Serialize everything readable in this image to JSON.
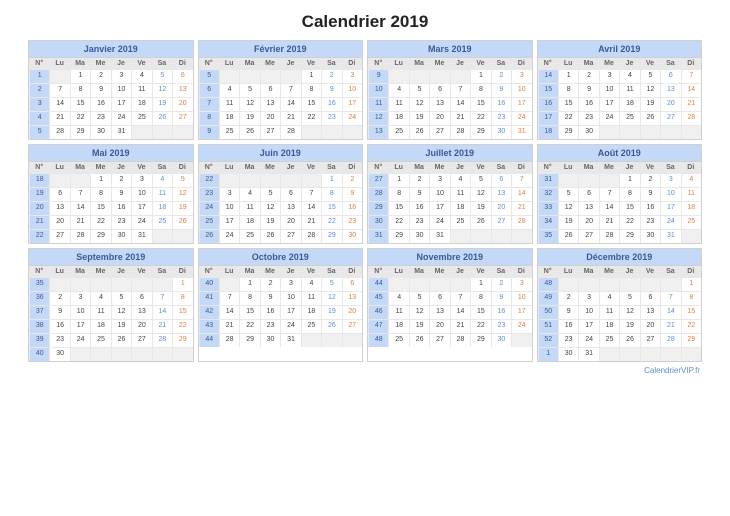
{
  "title": "Calendrier 2019",
  "footer": "CalendrierVIP.fr",
  "dayHeaders": [
    "N°",
    "Lu",
    "Ma",
    "Me",
    "Je",
    "Ve",
    "Sa",
    "Di"
  ],
  "months": [
    {
      "name": "Janvier 2019",
      "weeks": [
        {
          "n": 1,
          "d": [
            "",
            "1",
            "2",
            "3",
            "4",
            "5",
            "6"
          ]
        },
        {
          "n": 2,
          "d": [
            "7",
            "8",
            "9",
            "10",
            "11",
            "12",
            "13"
          ]
        },
        {
          "n": 3,
          "d": [
            "14",
            "15",
            "16",
            "17",
            "18",
            "19",
            "20"
          ]
        },
        {
          "n": 4,
          "d": [
            "21",
            "22",
            "23",
            "24",
            "25",
            "26",
            "27"
          ]
        },
        {
          "n": 5,
          "d": [
            "28",
            "29",
            "30",
            "31",
            "",
            "",
            ""
          ]
        }
      ]
    },
    {
      "name": "Février 2019",
      "weeks": [
        {
          "n": 5,
          "d": [
            "",
            "",
            "",
            "",
            "1",
            "2",
            "3"
          ]
        },
        {
          "n": 6,
          "d": [
            "4",
            "5",
            "6",
            "7",
            "8",
            "9",
            "10"
          ]
        },
        {
          "n": 7,
          "d": [
            "11",
            "12",
            "13",
            "14",
            "15",
            "16",
            "17"
          ]
        },
        {
          "n": 8,
          "d": [
            "18",
            "19",
            "20",
            "21",
            "22",
            "23",
            "24"
          ]
        },
        {
          "n": 9,
          "d": [
            "25",
            "26",
            "27",
            "28",
            "",
            "",
            ""
          ]
        }
      ]
    },
    {
      "name": "Mars 2019",
      "weeks": [
        {
          "n": 9,
          "d": [
            "",
            "",
            "",
            "",
            "1",
            "2",
            "3"
          ]
        },
        {
          "n": 10,
          "d": [
            "4",
            "5",
            "6",
            "7",
            "8",
            "9",
            "10"
          ]
        },
        {
          "n": 11,
          "d": [
            "11",
            "12",
            "13",
            "14",
            "15",
            "16",
            "17"
          ]
        },
        {
          "n": 12,
          "d": [
            "18",
            "19",
            "20",
            "21",
            "22",
            "23",
            "24"
          ]
        },
        {
          "n": 13,
          "d": [
            "25",
            "26",
            "27",
            "28",
            "29",
            "30",
            "31"
          ]
        }
      ]
    },
    {
      "name": "Avril 2019",
      "weeks": [
        {
          "n": 14,
          "d": [
            "1",
            "2",
            "3",
            "4",
            "5",
            "6",
            "7"
          ]
        },
        {
          "n": 15,
          "d": [
            "8",
            "9",
            "10",
            "11",
            "12",
            "13",
            "14"
          ]
        },
        {
          "n": 16,
          "d": [
            "15",
            "16",
            "17",
            "18",
            "19",
            "20",
            "21"
          ]
        },
        {
          "n": 17,
          "d": [
            "22",
            "23",
            "24",
            "25",
            "26",
            "27",
            "28"
          ]
        },
        {
          "n": 18,
          "d": [
            "29",
            "30",
            "",
            "",
            "",
            "",
            ""
          ]
        }
      ]
    },
    {
      "name": "Mai 2019",
      "weeks": [
        {
          "n": 18,
          "d": [
            "",
            "",
            "1",
            "2",
            "3",
            "4",
            "5"
          ]
        },
        {
          "n": 19,
          "d": [
            "6",
            "7",
            "8",
            "9",
            "10",
            "11",
            "12"
          ]
        },
        {
          "n": 20,
          "d": [
            "13",
            "14",
            "15",
            "16",
            "17",
            "18",
            "19"
          ]
        },
        {
          "n": 21,
          "d": [
            "20",
            "21",
            "22",
            "23",
            "24",
            "25",
            "26"
          ]
        },
        {
          "n": 22,
          "d": [
            "27",
            "28",
            "29",
            "30",
            "31",
            "",
            ""
          ]
        }
      ]
    },
    {
      "name": "Juin 2019",
      "weeks": [
        {
          "n": 22,
          "d": [
            "",
            "",
            "",
            "",
            "",
            "1",
            "2"
          ]
        },
        {
          "n": 23,
          "d": [
            "3",
            "4",
            "5",
            "6",
            "7",
            "8",
            "9"
          ]
        },
        {
          "n": 24,
          "d": [
            "10",
            "11",
            "12",
            "13",
            "14",
            "15",
            "16"
          ]
        },
        {
          "n": 25,
          "d": [
            "17",
            "18",
            "19",
            "20",
            "21",
            "22",
            "23"
          ]
        },
        {
          "n": 26,
          "d": [
            "24",
            "25",
            "26",
            "27",
            "28",
            "29",
            "30"
          ]
        }
      ]
    },
    {
      "name": "Juillet 2019",
      "weeks": [
        {
          "n": 27,
          "d": [
            "1",
            "2",
            "3",
            "4",
            "5",
            "6",
            "7"
          ]
        },
        {
          "n": 28,
          "d": [
            "8",
            "9",
            "10",
            "11",
            "12",
            "13",
            "14"
          ]
        },
        {
          "n": 29,
          "d": [
            "15",
            "16",
            "17",
            "18",
            "19",
            "20",
            "21"
          ]
        },
        {
          "n": 30,
          "d": [
            "22",
            "23",
            "24",
            "25",
            "26",
            "27",
            "28"
          ]
        },
        {
          "n": 31,
          "d": [
            "29",
            "30",
            "31",
            "",
            "",
            "",
            ""
          ]
        }
      ]
    },
    {
      "name": "Août 2019",
      "weeks": [
        {
          "n": 31,
          "d": [
            "",
            "",
            "",
            "1",
            "2",
            "3",
            "4"
          ]
        },
        {
          "n": 32,
          "d": [
            "5",
            "6",
            "7",
            "8",
            "9",
            "10",
            "11"
          ]
        },
        {
          "n": 33,
          "d": [
            "12",
            "13",
            "14",
            "15",
            "16",
            "17",
            "18"
          ]
        },
        {
          "n": 34,
          "d": [
            "19",
            "20",
            "21",
            "22",
            "23",
            "24",
            "25"
          ]
        },
        {
          "n": 35,
          "d": [
            "26",
            "27",
            "28",
            "29",
            "30",
            "31",
            ""
          ]
        }
      ]
    },
    {
      "name": "Septembre 2019",
      "weeks": [
        {
          "n": 35,
          "d": [
            "",
            "",
            "",
            "",
            "",
            "",
            "1"
          ]
        },
        {
          "n": 36,
          "d": [
            "2",
            "3",
            "4",
            "5",
            "6",
            "7",
            "8"
          ]
        },
        {
          "n": 37,
          "d": [
            "9",
            "10",
            "11",
            "12",
            "13",
            "14",
            "15"
          ]
        },
        {
          "n": 38,
          "d": [
            "16",
            "17",
            "18",
            "19",
            "20",
            "21",
            "22"
          ]
        },
        {
          "n": 39,
          "d": [
            "23",
            "24",
            "25",
            "26",
            "27",
            "28",
            "29"
          ]
        },
        {
          "n": 40,
          "d": [
            "30",
            "",
            "",
            "",
            "",
            "",
            ""
          ]
        }
      ]
    },
    {
      "name": "Octobre 2019",
      "weeks": [
        {
          "n": 40,
          "d": [
            "",
            "1",
            "2",
            "3",
            "4",
            "5",
            "6"
          ]
        },
        {
          "n": 41,
          "d": [
            "7",
            "8",
            "9",
            "10",
            "11",
            "12",
            "13"
          ]
        },
        {
          "n": 42,
          "d": [
            "14",
            "15",
            "16",
            "17",
            "18",
            "19",
            "20"
          ]
        },
        {
          "n": 43,
          "d": [
            "21",
            "22",
            "23",
            "24",
            "25",
            "26",
            "27"
          ]
        },
        {
          "n": 44,
          "d": [
            "28",
            "29",
            "30",
            "31",
            "",
            "",
            ""
          ]
        }
      ]
    },
    {
      "name": "Novembre 2019",
      "weeks": [
        {
          "n": 44,
          "d": [
            "",
            "",
            "",
            "",
            "1",
            "2",
            "3"
          ]
        },
        {
          "n": 45,
          "d": [
            "4",
            "5",
            "6",
            "7",
            "8",
            "9",
            "10"
          ]
        },
        {
          "n": 46,
          "d": [
            "11",
            "12",
            "13",
            "14",
            "15",
            "16",
            "17"
          ]
        },
        {
          "n": 47,
          "d": [
            "18",
            "19",
            "20",
            "21",
            "22",
            "23",
            "24"
          ]
        },
        {
          "n": 48,
          "d": [
            "25",
            "26",
            "27",
            "28",
            "29",
            "30",
            ""
          ]
        }
      ]
    },
    {
      "name": "Décembre 2019",
      "weeks": [
        {
          "n": 48,
          "d": [
            "",
            "",
            "",
            "",
            "",
            "",
            "1"
          ]
        },
        {
          "n": 49,
          "d": [
            "2",
            "3",
            "4",
            "5",
            "6",
            "7",
            "8"
          ]
        },
        {
          "n": 50,
          "d": [
            "9",
            "10",
            "11",
            "12",
            "13",
            "14",
            "15"
          ]
        },
        {
          "n": 51,
          "d": [
            "16",
            "17",
            "18",
            "19",
            "20",
            "21",
            "22"
          ]
        },
        {
          "n": 52,
          "d": [
            "23",
            "24",
            "25",
            "26",
            "27",
            "28",
            "29"
          ]
        },
        {
          "n": 1,
          "d": [
            "30",
            "31",
            "",
            "",
            "",
            "",
            ""
          ]
        }
      ]
    }
  ]
}
